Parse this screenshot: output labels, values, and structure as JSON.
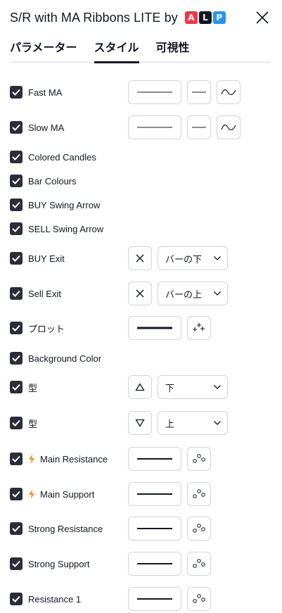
{
  "header": {
    "title": "S/R with MA Ribbons LITE by"
  },
  "badges": [
    {
      "letter": "A",
      "color": "#f23645"
    },
    {
      "letter": "L",
      "color": "#131722"
    },
    {
      "letter": "P",
      "color": "#2196f3"
    }
  ],
  "tabs": [
    "パラメーター",
    "スタイル",
    "可視性"
  ],
  "active_tab": "スタイル",
  "rows": {
    "fast_ma": "Fast MA",
    "slow_ma": "Slow MA",
    "colored_candles": "Colored Candles",
    "bar_colours": "Bar Colours",
    "buy_swing_arrow": "BUY Swing Arrow",
    "sell_swing_arrow": "SELL Swing Arrow",
    "buy_exit": "BUY Exit",
    "sell_exit": "Sell Exit",
    "plot": "プロット",
    "background_color": "Background Color",
    "shape_up": "型",
    "shape_down": "型",
    "main_resistance": "Main Resistance",
    "main_support": "Main Support",
    "strong_resistance": "Strong Resistance",
    "strong_support": "Strong Support",
    "resistance_1": "Resistance 1"
  },
  "dropdowns": {
    "buy_exit_location": "バーの下",
    "sell_exit_location": "バーの上",
    "shape_up_location": "下",
    "shape_down_location": "上"
  },
  "colors": {
    "checkbox": "#2a2e39",
    "bolt": "#f7931a",
    "border": "#d1d4dc"
  }
}
